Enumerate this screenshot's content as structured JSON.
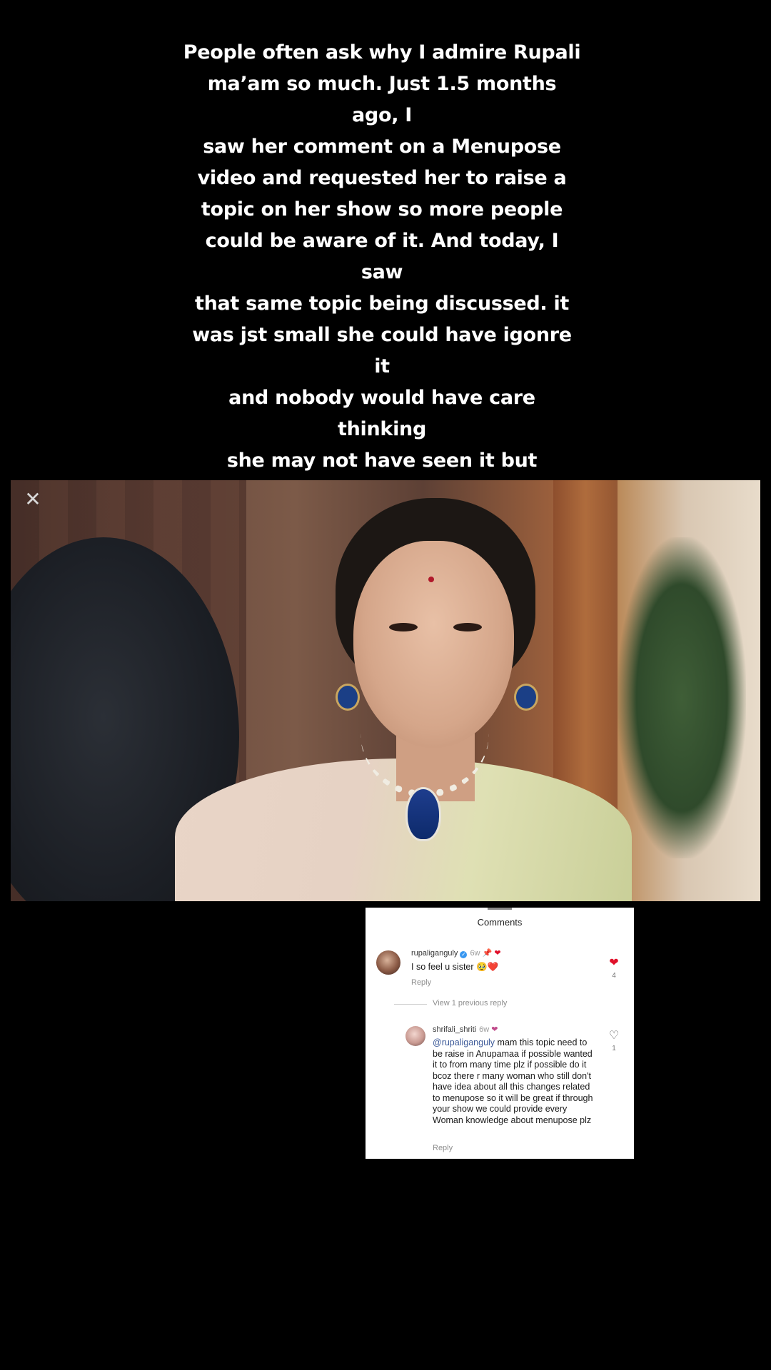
{
  "caption": {
    "text": "People often ask why I admire Rupali\nma’am so much. Just 1.5 months ago, I\nsaw her comment on a Menupose\nvideo and requested her to raise a\ntopic on her show so more people\ncould be aware of it. And today, I saw\nthat same topic being discussed. it\nwas jst small she could have igonre it\nand nobody would have care thinking\nshe may not have seen it  but Whether\nshe was there or not, she made sure it\nwas raised and that’s the beauty of her\nand her show. This is why I lose my\nheart every single time",
    "emoji": "❤️"
  },
  "video": {
    "watermark_icon": "capcut-logo-icon"
  },
  "comments_panel": {
    "title": "Comments",
    "comments": [
      {
        "username": "rupaliganguly",
        "verified": true,
        "time": "6w",
        "badges": "📌",
        "text": "I so feel u sister 🥹❤️",
        "reply_label": "Reply",
        "likes": "4",
        "liked": true
      }
    ],
    "view_previous": "View 1 previous reply",
    "replies": [
      {
        "username": "shrifali_shriti",
        "time": "6w",
        "mention": "@rupaliganguly",
        "text": " mam this topic need to be raise in Anupamaa if possible wanted it to from many time plz if possible do it bcoz there r many woman who still don't have idea about all this changes related to menupose so it will be great if through your show we could provide every Woman knowledge about menupose plz",
        "reply_label": "Reply",
        "likes": "1",
        "liked": false
      }
    ]
  }
}
